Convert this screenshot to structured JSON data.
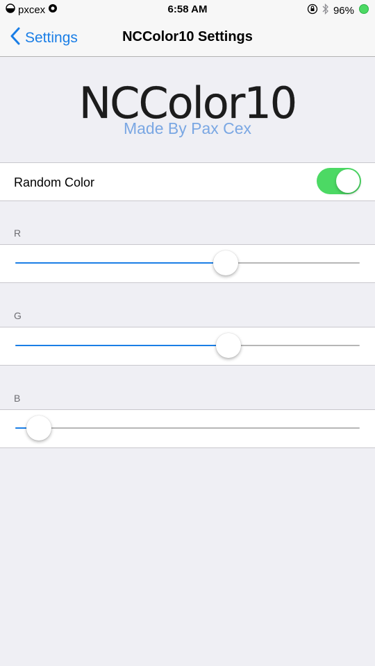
{
  "status_bar": {
    "carrier": "pxcex",
    "time": "6:58 AM",
    "battery_percent": "96%",
    "icons": [
      "signal-icon",
      "wifi-icon",
      "orientation-lock-icon",
      "bluetooth-icon",
      "battery-icon"
    ]
  },
  "navbar": {
    "back_label": "Settings",
    "title": "NCColor10 Settings"
  },
  "header": {
    "logo_text": "NCColor10",
    "subtitle": "Made By Pax Cex"
  },
  "random_color": {
    "label": "Random Color",
    "enabled": true
  },
  "sliders": [
    {
      "label": "R",
      "value": 0.61
    },
    {
      "label": "G",
      "value": 0.618
    },
    {
      "label": "B",
      "value": 0.035
    }
  ],
  "colors": {
    "accent": "#1a7ee6",
    "switch_on": "#4cd964",
    "subtitle": "#7aa7e3",
    "background": "#efeff4"
  }
}
